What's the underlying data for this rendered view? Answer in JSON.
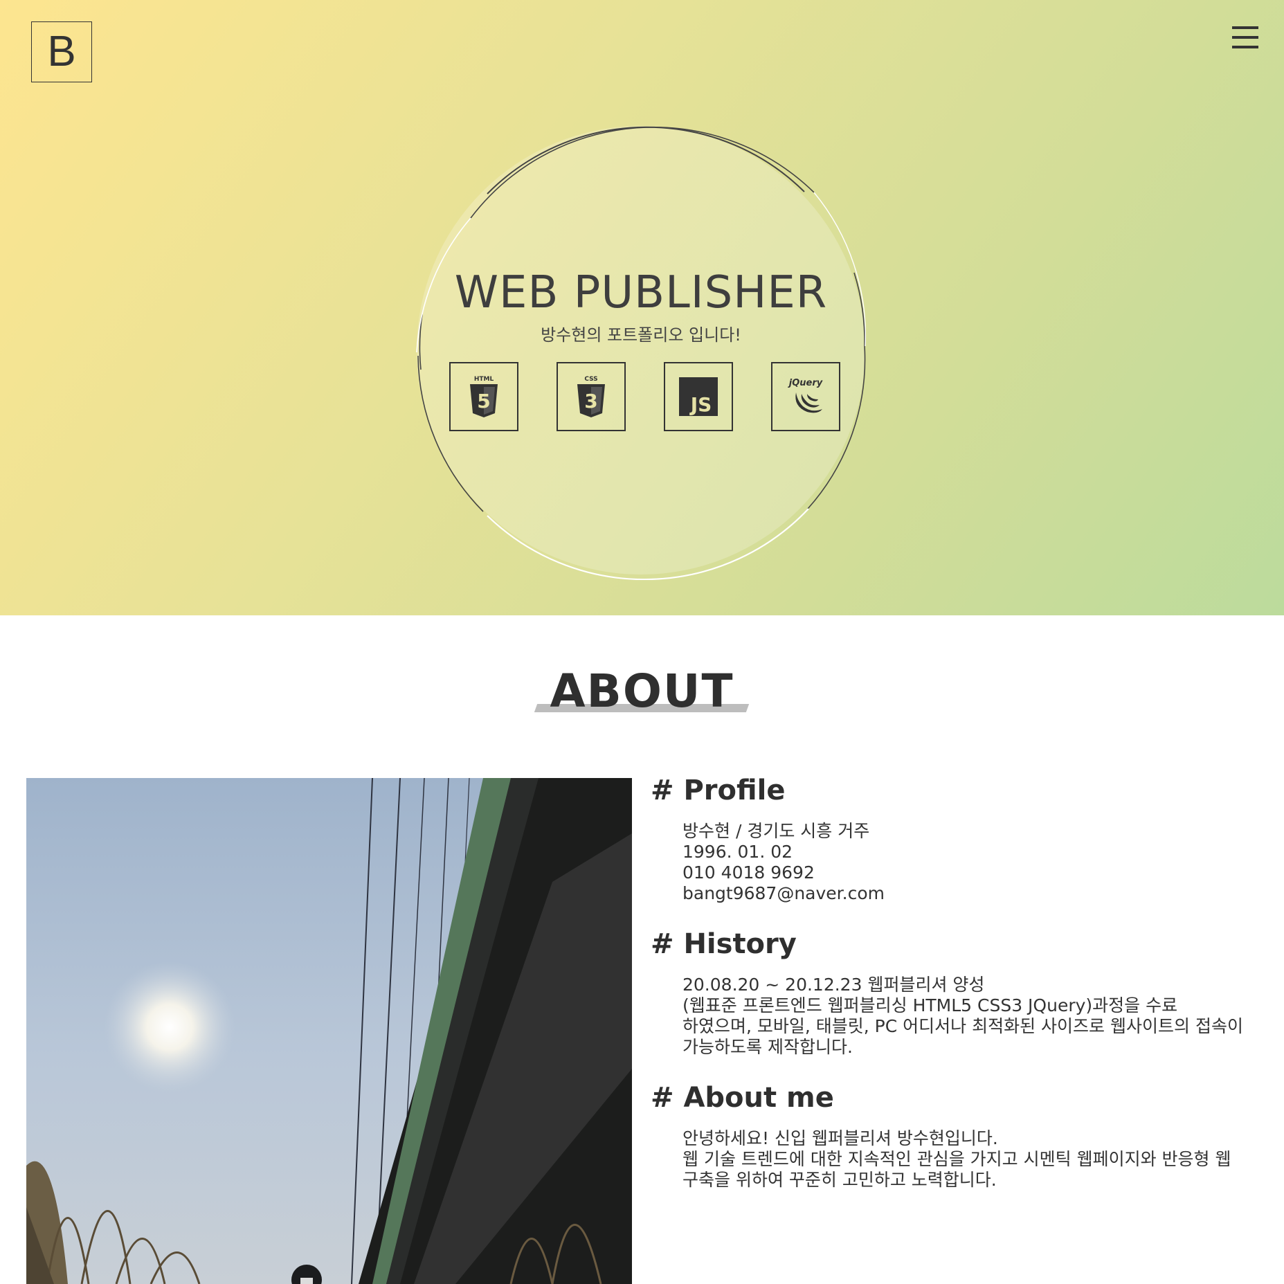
{
  "header": {
    "logo_letter": "B",
    "menu_icon": "hamburger-menu-icon"
  },
  "hero": {
    "title": "WEB PUBLISHER",
    "subtitle": "방수현의 포트폴리오 입니다!",
    "skills": [
      {
        "icon": "html5-icon",
        "label": "HTML",
        "mark": "5"
      },
      {
        "icon": "css3-icon",
        "label": "CSS",
        "mark": "3"
      },
      {
        "icon": "javascript-icon",
        "label": "JS"
      },
      {
        "icon": "jquery-icon",
        "label": "jQuery"
      }
    ],
    "colors": {
      "gradient_start": "#fde590",
      "gradient_end": "#bcdb9c"
    }
  },
  "about": {
    "title": "ABOUT",
    "sections": [
      {
        "heading": "# Profile",
        "lines": [
          "방수현 / 경기도 시흥 거주",
          "1996. 01. 02",
          "010 4018 9692",
          "bangt9687@naver.com"
        ]
      },
      {
        "heading": "# History",
        "lines": [
          "20.08.20 ~ 20.12.23 웹퍼블리셔 양성",
          "(웹표준 프론트엔드 웹퍼블리싱 HTML5 CSS3 JQuery)과정을 수료",
          "하였으며, 모바일, 태블릿, PC 어디서나 최적화된 사이즈로 웹사이트의 접속이",
          "가능하도록 제작합니다."
        ]
      },
      {
        "heading": "# About me",
        "lines": [
          "안녕하세요! 신입 웹퍼블리셔 방수현입니다.",
          "웹 기술 트렌드에 대한 지속적인 관심을 가지고 시멘틱 웹페이지와 반응형 웹",
          "구축을 위하여 꾸준히 고민하고 노력합니다."
        ]
      }
    ]
  }
}
